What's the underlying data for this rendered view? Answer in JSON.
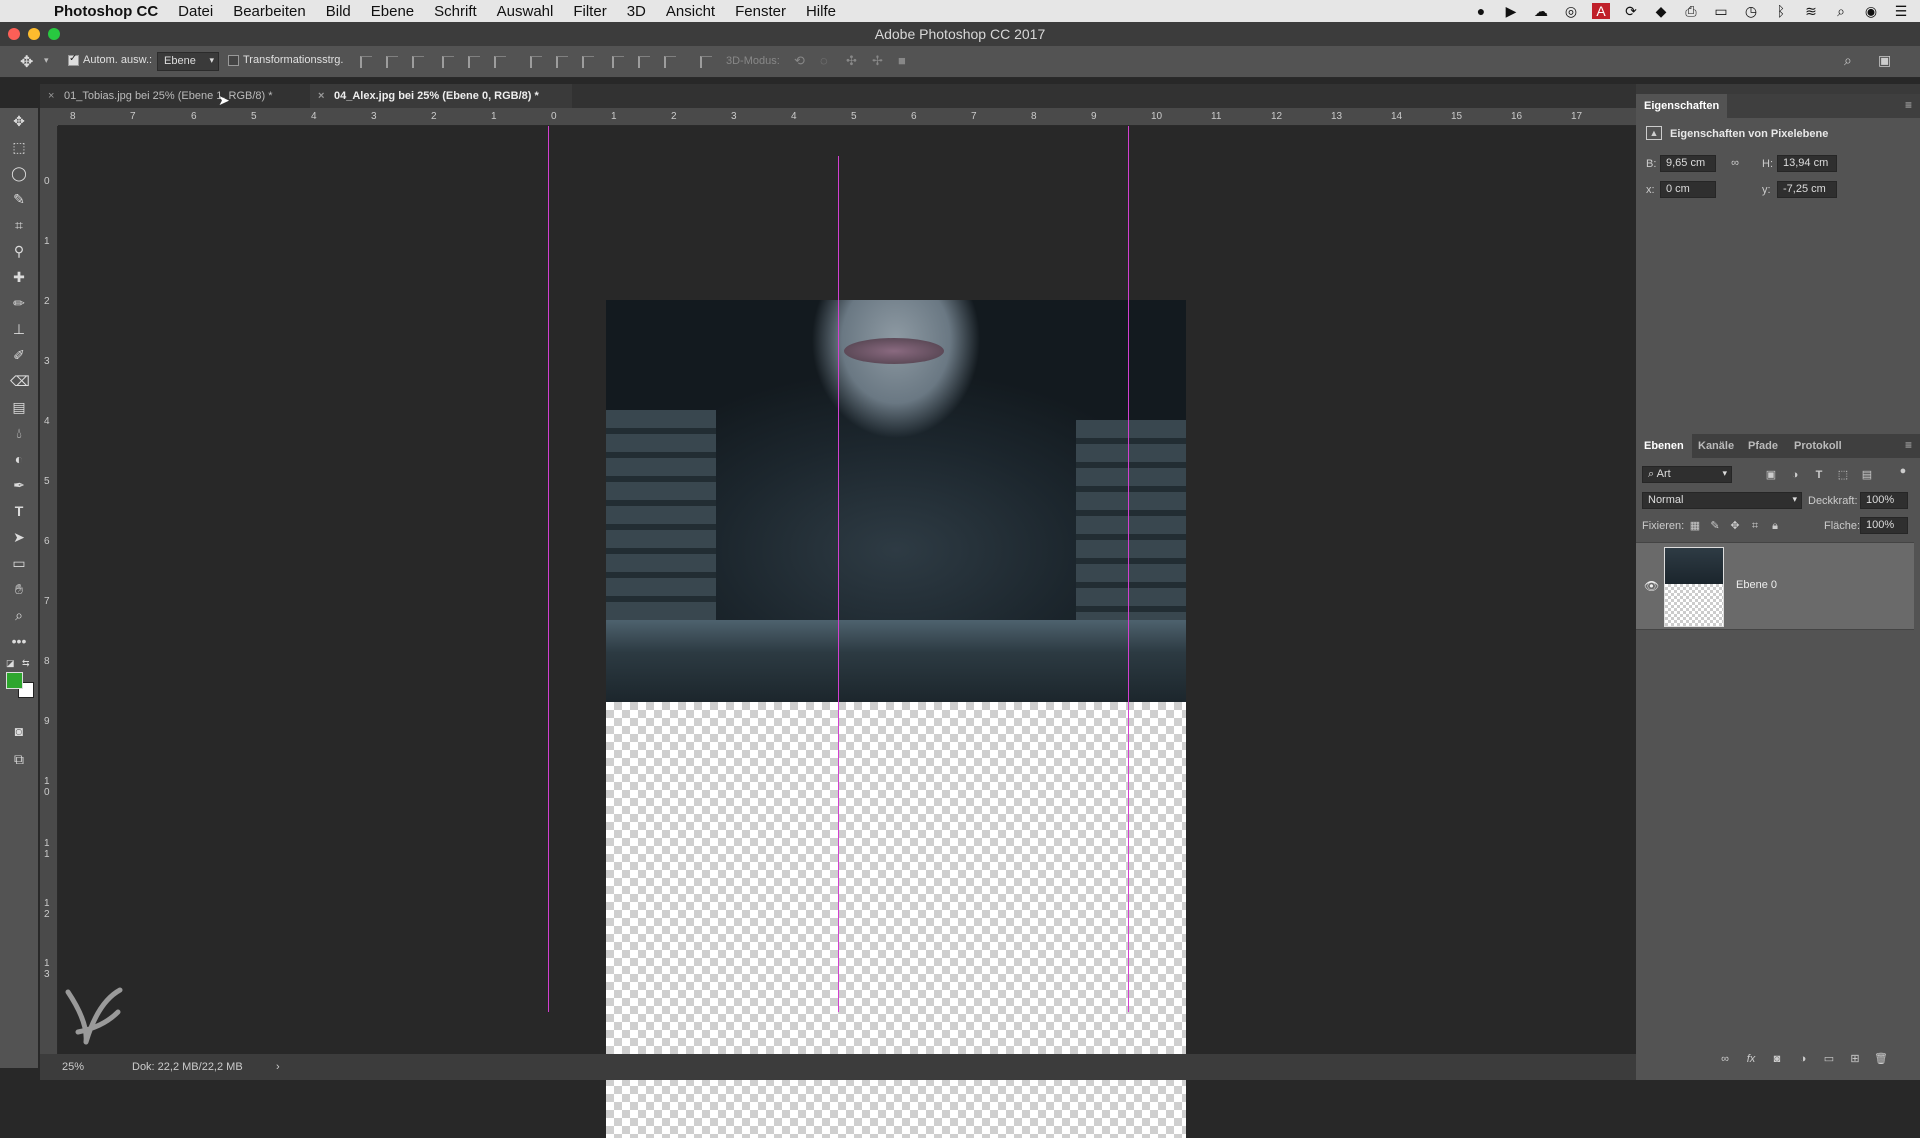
{
  "menubar": {
    "app_name": "Photoshop CC",
    "items": [
      "Datei",
      "Bearbeiten",
      "Bild",
      "Ebene",
      "Schrift",
      "Auswahl",
      "Filter",
      "3D",
      "Ansicht",
      "Fenster",
      "Hilfe"
    ]
  },
  "window": {
    "title": "Adobe Photoshop CC 2017"
  },
  "options": {
    "auto_select_label": "Autom. ausw.:",
    "auto_select_value": "Ebene",
    "transform_label": "Transformationsstrg.",
    "mode_3d_label": "3D-Modus:"
  },
  "tabs": [
    {
      "label": "01_Tobias.jpg bei 25% (Ebene 1, RGB/8) *",
      "active": false
    },
    {
      "label": "04_Alex.jpg bei 25% (Ebene 0, RGB/8) *",
      "active": true
    }
  ],
  "ruler": {
    "h_marks": [
      "8",
      "7",
      "6",
      "5",
      "4",
      "3",
      "2",
      "1",
      "0",
      "1",
      "2",
      "3",
      "4",
      "5",
      "6",
      "7",
      "8",
      "9",
      "10",
      "11",
      "12",
      "13",
      "14",
      "15",
      "16",
      "17"
    ],
    "v_marks": [
      "0",
      "1",
      "2",
      "3",
      "4",
      "5",
      "6",
      "7",
      "8",
      "9",
      "10",
      "11",
      "12",
      "13"
    ]
  },
  "statusbar": {
    "zoom": "25%",
    "doc_info": "Dok: 22,2 MB/22,2 MB"
  },
  "properties": {
    "panel_title": "Eigenschaften",
    "subtitle": "Eigenschaften von Pixelebene",
    "w_label": "B:",
    "w_value": "9,65 cm",
    "h_label": "H:",
    "h_value": "13,94 cm",
    "x_label": "x:",
    "x_value": "0 cm",
    "y_label": "y:",
    "y_value": "-7,25 cm",
    "link_icon": "link-icon"
  },
  "layers_panel": {
    "tabs": [
      "Ebenen",
      "Kanäle",
      "Pfade",
      "Protokoll"
    ],
    "filter_value": "Art",
    "blend_mode": "Normal",
    "opacity_label": "Deckkraft:",
    "opacity_value": "100%",
    "lock_label": "Fixieren:",
    "fill_label": "Fläche:",
    "fill_value": "100%",
    "layers": [
      {
        "name": "Ebene 0",
        "visible": true
      }
    ]
  },
  "colors": {
    "foreground": "#2ea62e",
    "background": "#ffffff",
    "guide": "#d23fd0"
  }
}
